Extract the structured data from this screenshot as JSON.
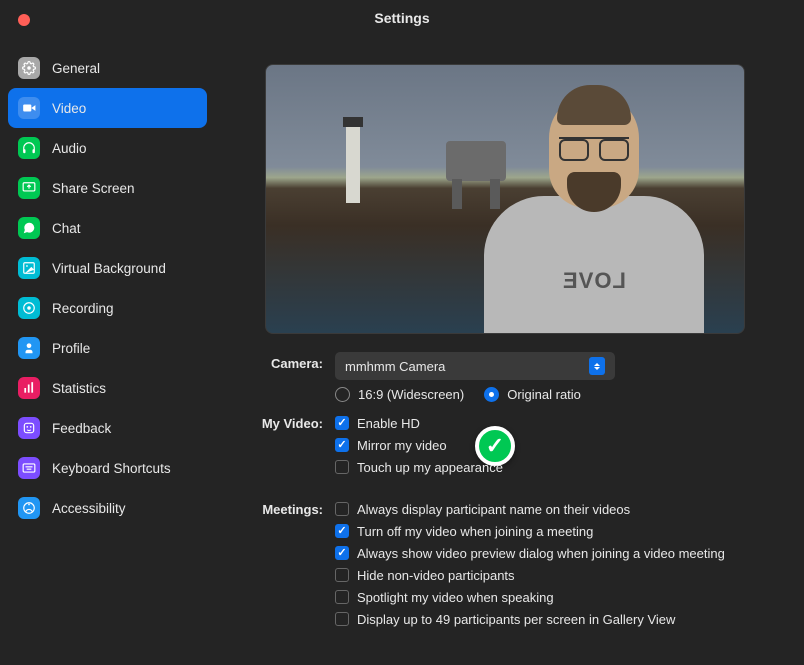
{
  "window": {
    "title": "Settings"
  },
  "sidebar": {
    "items": [
      {
        "label": "General",
        "icon_bg": "#a8a8a8"
      },
      {
        "label": "Video",
        "icon_bg": "#0e71eb"
      },
      {
        "label": "Audio",
        "icon_bg": "#00c853"
      },
      {
        "label": "Share Screen",
        "icon_bg": "#00c853"
      },
      {
        "label": "Chat",
        "icon_bg": "#00c853"
      },
      {
        "label": "Virtual Background",
        "icon_bg": "#00bcd4"
      },
      {
        "label": "Recording",
        "icon_bg": "#00bcd4"
      },
      {
        "label": "Profile",
        "icon_bg": "#2196f3"
      },
      {
        "label": "Statistics",
        "icon_bg": "#e91e63"
      },
      {
        "label": "Feedback",
        "icon_bg": "#7c4dff"
      },
      {
        "label": "Keyboard Shortcuts",
        "icon_bg": "#7c4dff"
      },
      {
        "label": "Accessibility",
        "icon_bg": "#2196f3"
      }
    ],
    "active_index": 1
  },
  "camera": {
    "label": "Camera:",
    "selected": "mmhmm Camera",
    "aspect_ratio": {
      "widescreen_label": "16:9 (Widescreen)",
      "original_label": "Original ratio",
      "selected": "original"
    }
  },
  "my_video": {
    "label": "My Video:",
    "options": [
      {
        "label": "Enable HD",
        "checked": true
      },
      {
        "label": "Mirror my video",
        "checked": true,
        "annotated": true
      },
      {
        "label": "Touch up my appearance",
        "checked": false
      }
    ]
  },
  "meetings": {
    "label": "Meetings:",
    "options": [
      {
        "label": "Always display participant name on their videos",
        "checked": false
      },
      {
        "label": "Turn off my video when joining a meeting",
        "checked": true
      },
      {
        "label": "Always show video preview dialog when joining a video meeting",
        "checked": true
      },
      {
        "label": "Hide non-video participants",
        "checked": false
      },
      {
        "label": "Spotlight my video when speaking",
        "checked": false
      },
      {
        "label": "Display up to 49 participants per screen in Gallery View",
        "checked": false
      }
    ]
  },
  "preview": {
    "shirt_text": "LOVE"
  }
}
